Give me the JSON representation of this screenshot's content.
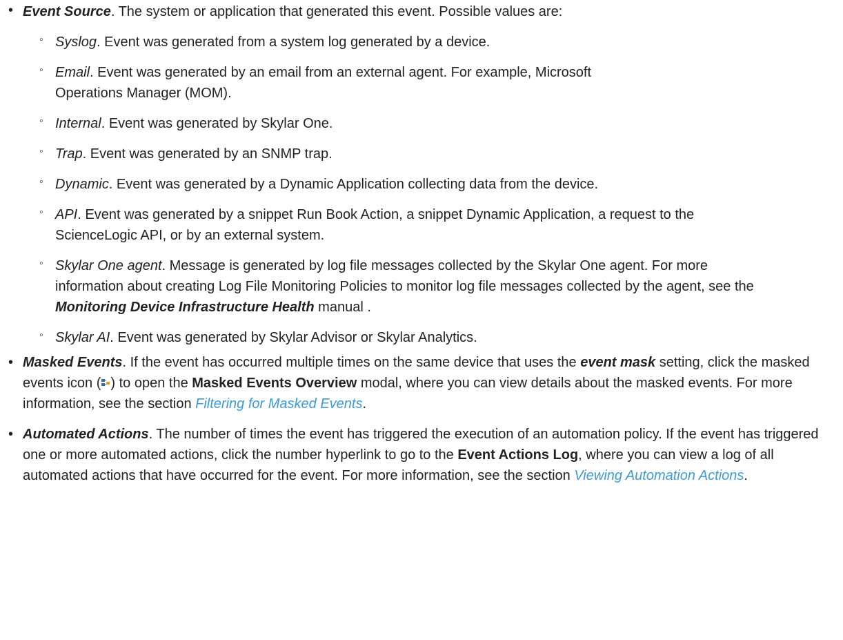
{
  "items": {
    "event_source": {
      "term": "Event Source",
      "text": ". The system or application that generated this event. Possible values are:",
      "subitems": [
        {
          "term": "Syslog",
          "text": ". Event was generated from a system log generated by a device."
        },
        {
          "term": "Email",
          "text": ". Event was generated by an email from an external agent. For example, Microsoft Operations Manager (MOM)."
        },
        {
          "term": "Internal",
          "text": ". Event was generated by Skylar One."
        },
        {
          "term": "Trap",
          "text": ". Event was generated by an SNMP trap."
        },
        {
          "term": "Dynamic",
          "text": ". Event was generated by a Dynamic Application collecting data from the device."
        },
        {
          "term": "API",
          "text": ". Event was generated by a snippet Run Book Action, a snippet Dynamic Application, a request to the ScienceLogic API, or by an external system."
        },
        {
          "term": "Skylar One agent",
          "text": ". Message is generated by log file messages collected by the Skylar One agent. For more information about creating Log File Monitoring Policies to monitor log file messages collected by the agent, see the ",
          "manual_title": "Monitoring Device Infrastructure Health",
          "text_after": " manual ."
        },
        {
          "term": "Skylar AI",
          "text": ". Event was generated by Skylar Advisor or Skylar Analytics."
        }
      ]
    },
    "masked_events": {
      "term": "Masked Events",
      "text1": ". If the event has occurred multiple times on the same device that uses the ",
      "emph": "event mask",
      "text2": " setting, click the masked events icon (",
      "text3": ") to open the ",
      "ui": "Masked Events Overview",
      "text4": " modal, where you can view details about the masked events. For more information, see the section ",
      "link": "Filtering for Masked Events",
      "text5": "."
    },
    "automated_actions": {
      "term": "Automated Actions",
      "text1": ". The number of times the event has triggered the execution of an automation policy. If the event has triggered one or more automated actions, click the number hyperlink to go to the ",
      "ui": "Event Actions Log",
      "text2": ", where you can view a log of all automated actions that have occurred for the event. For more information, see the section ",
      "link": "Viewing Automation Actions",
      "text3": "."
    }
  },
  "bullets": {
    "top": "•",
    "sub": "◦"
  },
  "colors": {
    "text": "#222222",
    "link": "#3c9bd6",
    "icon": "#2f6fb0"
  },
  "icons": {
    "masked_events": "masked-events-icon"
  }
}
